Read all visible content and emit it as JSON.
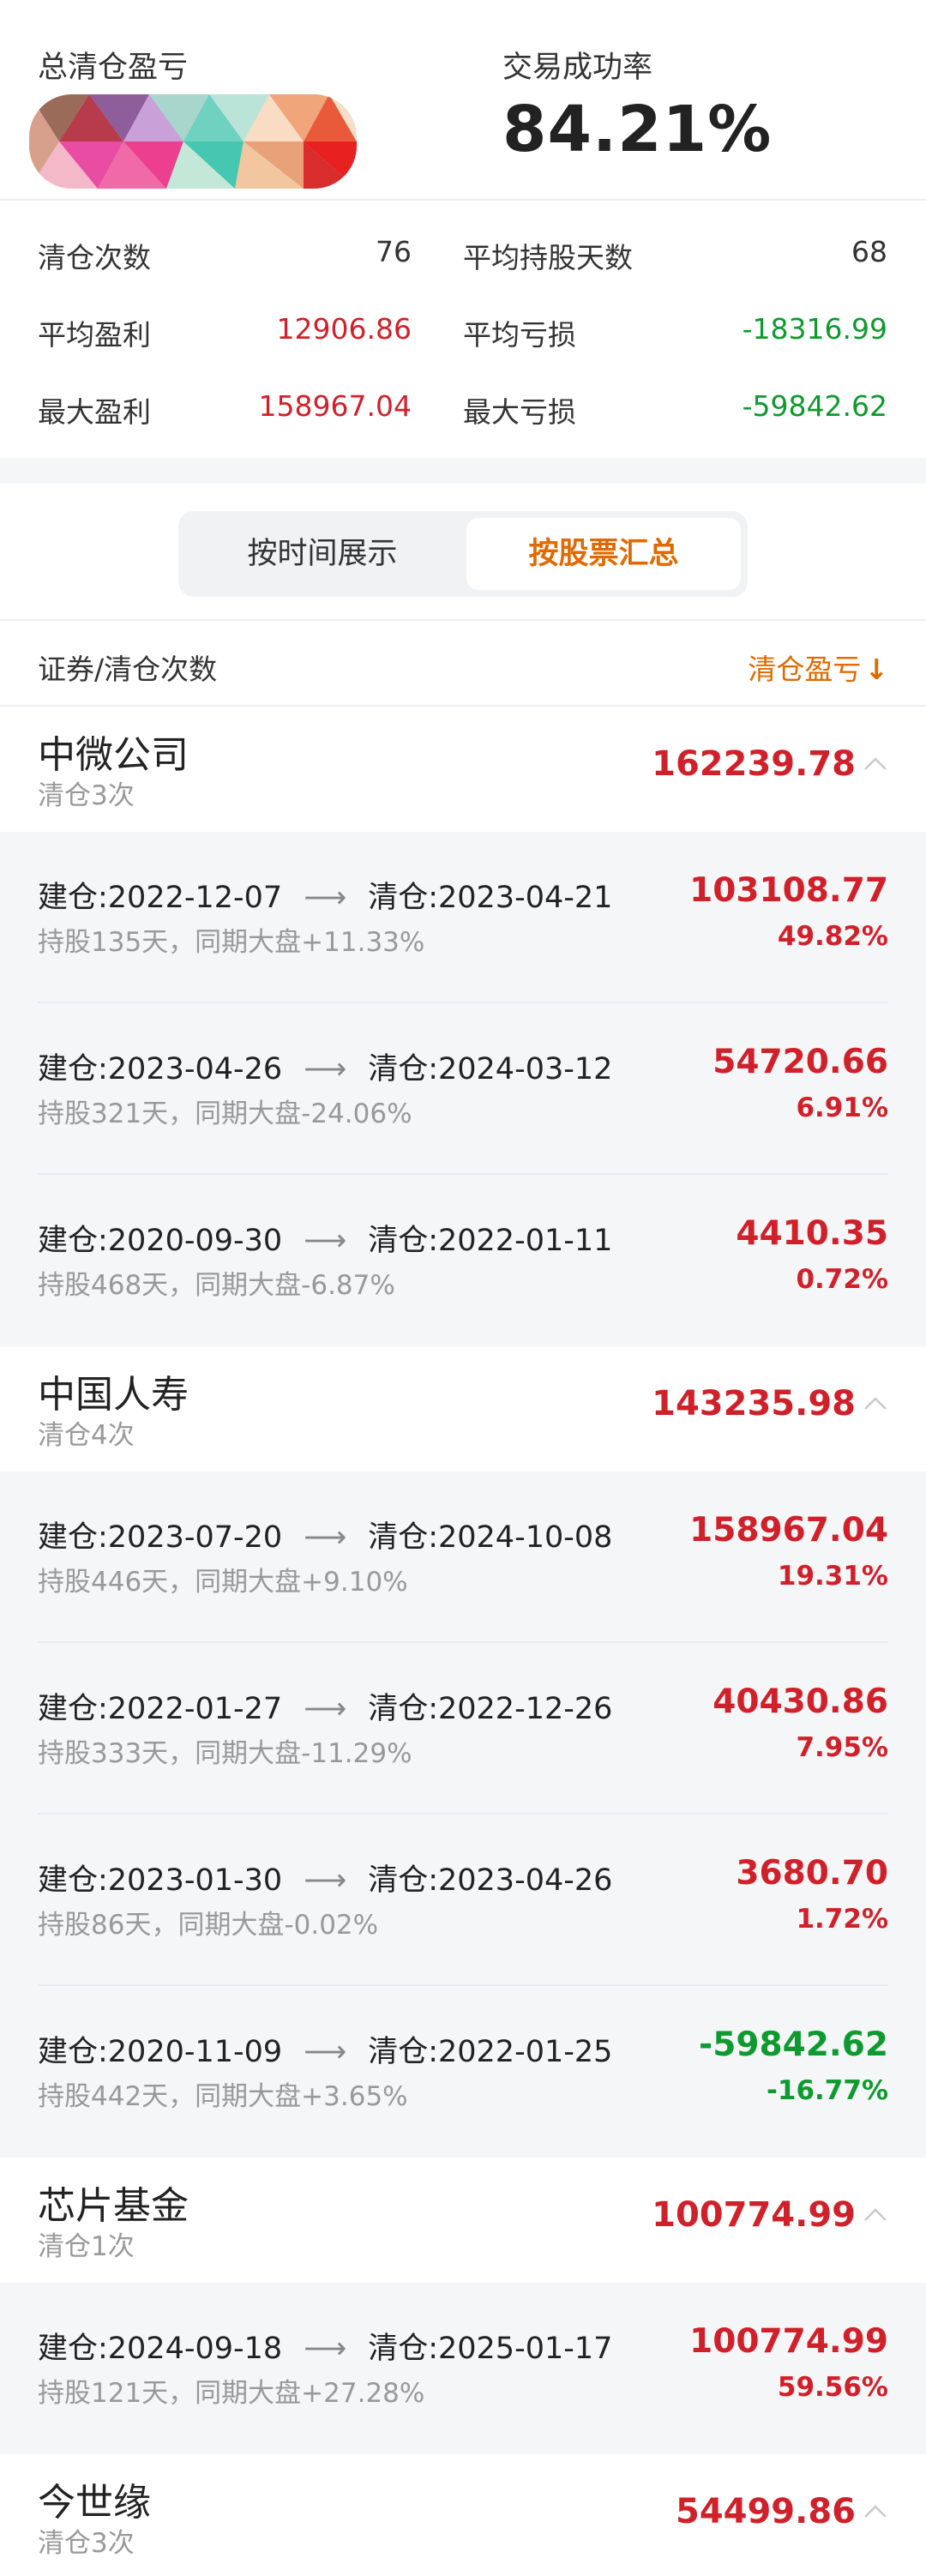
{
  "summary": {
    "total_label": "总清仓盈亏",
    "rate_label": "交易成功率",
    "rate_value": "84.21%"
  },
  "stats": {
    "clear_count_label": "清仓次数",
    "clear_count": "76",
    "avg_hold_label": "平均持股天数",
    "avg_hold": "68",
    "avg_profit_label": "平均盈利",
    "avg_profit": "12906.86",
    "avg_loss_label": "平均亏损",
    "avg_loss": "-18316.99",
    "max_profit_label": "最大盈利",
    "max_profit": "158967.04",
    "max_loss_label": "最大亏损",
    "max_loss": "-59842.62"
  },
  "tabs": {
    "by_time": "按时间展示",
    "by_stock": "按股票汇总"
  },
  "columns": {
    "left": "证券/清仓次数",
    "right": "清仓盈亏",
    "sort_icon": "↓"
  },
  "colors": {
    "red": "#d0212a",
    "green": "#0e9a2f",
    "orange": "#e06a00"
  },
  "groups": [
    {
      "name": "中微公司",
      "count": "清仓3次",
      "total": "162239.78",
      "records": [
        {
          "open": "建仓:2022-12-07",
          "close": "清仓:2023-04-21",
          "hold": "持股135天，同期大盘+11.33%",
          "amount": "103108.77",
          "pct": "49.82%",
          "sign": "up"
        },
        {
          "open": "建仓:2023-04-26",
          "close": "清仓:2024-03-12",
          "hold": "持股321天，同期大盘-24.06%",
          "amount": "54720.66",
          "pct": "6.91%",
          "sign": "up"
        },
        {
          "open": "建仓:2020-09-30",
          "close": "清仓:2022-01-11",
          "hold": "持股468天，同期大盘-6.87%",
          "amount": "4410.35",
          "pct": "0.72%",
          "sign": "up"
        }
      ]
    },
    {
      "name": "中国人寿",
      "count": "清仓4次",
      "total": "143235.98",
      "records": [
        {
          "open": "建仓:2023-07-20",
          "close": "清仓:2024-10-08",
          "hold": "持股446天，同期大盘+9.10%",
          "amount": "158967.04",
          "pct": "19.31%",
          "sign": "up"
        },
        {
          "open": "建仓:2022-01-27",
          "close": "清仓:2022-12-26",
          "hold": "持股333天，同期大盘-11.29%",
          "amount": "40430.86",
          "pct": "7.95%",
          "sign": "up"
        },
        {
          "open": "建仓:2023-01-30",
          "close": "清仓:2023-04-26",
          "hold": "持股86天，同期大盘-0.02%",
          "amount": "3680.70",
          "pct": "1.72%",
          "sign": "up"
        },
        {
          "open": "建仓:2020-11-09",
          "close": "清仓:2022-01-25",
          "hold": "持股442天，同期大盘+3.65%",
          "amount": "-59842.62",
          "pct": "-16.77%",
          "sign": "down"
        }
      ]
    },
    {
      "name": "芯片基金",
      "count": "清仓1次",
      "total": "100774.99",
      "records": [
        {
          "open": "建仓:2024-09-18",
          "close": "清仓:2025-01-17",
          "hold": "持股121天，同期大盘+27.28%",
          "amount": "100774.99",
          "pct": "59.56%",
          "sign": "up"
        }
      ]
    },
    {
      "name": "今世缘",
      "count": "清仓3次",
      "total": "54499.86",
      "records": []
    }
  ]
}
